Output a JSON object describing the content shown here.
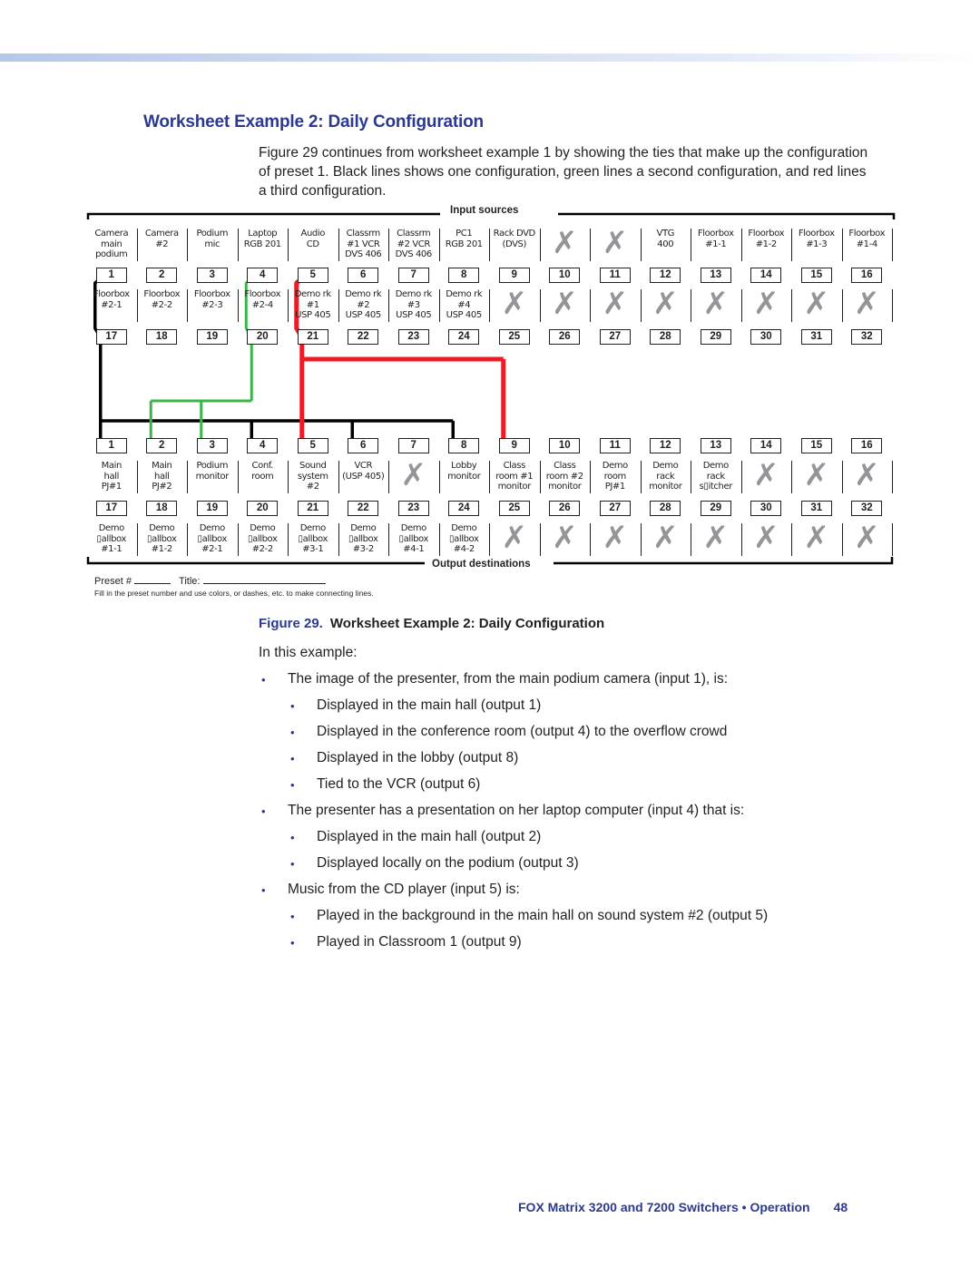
{
  "header": {
    "section_title": "Worksheet Example 2: Daily Configuration",
    "intro": "Figure 29 continues from worksheet example 1 by showing the ties that make up the configuration of preset 1. Black lines shows one configuration, green lines a second configuration, and red lines a third configuration."
  },
  "diagram": {
    "inputs_label": "Input  sources",
    "outputs_label": "Output destinations",
    "colors": {
      "black": "#000000",
      "green": "#39b54a",
      "red": "#ed1c24",
      "x_mark": "#939598"
    },
    "x_glyph": "✗",
    "inputs": [
      {
        "num": "1",
        "label": "Camera\nmain\npodium"
      },
      {
        "num": "2",
        "label": "Camera\n#2"
      },
      {
        "num": "3",
        "label": "Podium\nmic"
      },
      {
        "num": "4",
        "label": "Laptop\nRGB 201"
      },
      {
        "num": "5",
        "label": "Audio\nCD"
      },
      {
        "num": "6",
        "label": "Classrm\n#1 VCR\nDVS 406"
      },
      {
        "num": "7",
        "label": "Classrm\n#2 VCR\nDVS 406"
      },
      {
        "num": "8",
        "label": "PC1\nRGB 201"
      },
      {
        "num": "9",
        "label": "Rack DVD\n(DVS)"
      },
      {
        "num": "10",
        "label": null
      },
      {
        "num": "11",
        "label": null
      },
      {
        "num": "12",
        "label": "VTG\n400"
      },
      {
        "num": "13",
        "label": "Floorbox\n#1-1"
      },
      {
        "num": "14",
        "label": "Floorbox\n#1-2"
      },
      {
        "num": "15",
        "label": "Floorbox\n#1-3"
      },
      {
        "num": "16",
        "label": "Floorbox\n#1-4"
      },
      {
        "num": "17",
        "label": "Floorbox\n#2-1"
      },
      {
        "num": "18",
        "label": "Floorbox\n#2-2"
      },
      {
        "num": "19",
        "label": "Floorbox\n#2-3"
      },
      {
        "num": "20",
        "label": "Floorbox\n#2-4"
      },
      {
        "num": "21",
        "label": "Demo rk\n#1\nUSP 405"
      },
      {
        "num": "22",
        "label": "Demo rk\n#2\nUSP 405"
      },
      {
        "num": "23",
        "label": "Demo rk\n#3\nUSP 405"
      },
      {
        "num": "24",
        "label": "Demo rk\n#4\nUSP 405"
      },
      {
        "num": "25",
        "label": null
      },
      {
        "num": "26",
        "label": null
      },
      {
        "num": "27",
        "label": null
      },
      {
        "num": "28",
        "label": null
      },
      {
        "num": "29",
        "label": null
      },
      {
        "num": "30",
        "label": null
      },
      {
        "num": "31",
        "label": null
      },
      {
        "num": "32",
        "label": null
      }
    ],
    "outputs": [
      {
        "num": "1",
        "label": "Main\nhall\nPJ#1"
      },
      {
        "num": "2",
        "label": "Main\nhall\nPJ#2"
      },
      {
        "num": "3",
        "label": "Podium\nmonitor"
      },
      {
        "num": "4",
        "label": "Conf.\nroom"
      },
      {
        "num": "5",
        "label": "Sound\nsystem\n#2"
      },
      {
        "num": "6",
        "label": "VCR\n(USP 405)"
      },
      {
        "num": "7",
        "label": null
      },
      {
        "num": "8",
        "label": "Lobby\nmonitor"
      },
      {
        "num": "9",
        "label": "Class\nroom #1\nmonitor"
      },
      {
        "num": "10",
        "label": "Class\nroom #2\nmonitor"
      },
      {
        "num": "11",
        "label": "Demo\nroom\nPJ#1"
      },
      {
        "num": "12",
        "label": "Demo\nrack\nmonitor"
      },
      {
        "num": "13",
        "label": "Demo\nrack\ns▯itcher"
      },
      {
        "num": "14",
        "label": null
      },
      {
        "num": "15",
        "label": null
      },
      {
        "num": "16",
        "label": null
      },
      {
        "num": "17",
        "label": "Demo\n▯allbox\n#1-1"
      },
      {
        "num": "18",
        "label": "Demo\n▯allbox\n#1-2"
      },
      {
        "num": "19",
        "label": "Demo\n▯allbox\n#2-1"
      },
      {
        "num": "20",
        "label": "Demo\n▯allbox\n#2-2"
      },
      {
        "num": "21",
        "label": "Demo\n▯allbox\n#3-1"
      },
      {
        "num": "22",
        "label": "Demo\n▯allbox\n#3-2"
      },
      {
        "num": "23",
        "label": "Demo\n▯allbox\n#4-1"
      },
      {
        "num": "24",
        "label": "Demo\n▯allbox\n#4-2"
      },
      {
        "num": "25",
        "label": null
      },
      {
        "num": "26",
        "label": null
      },
      {
        "num": "27",
        "label": null
      },
      {
        "num": "28",
        "label": null
      },
      {
        "num": "29",
        "label": null
      },
      {
        "num": "30",
        "label": null
      },
      {
        "num": "31",
        "label": null
      },
      {
        "num": "32",
        "label": null
      }
    ],
    "ties": [
      {
        "color": "black",
        "input": 1,
        "outputs": [
          1,
          4,
          6,
          8
        ]
      },
      {
        "color": "green",
        "input": 4,
        "outputs": [
          2,
          3
        ]
      },
      {
        "color": "red",
        "input": 5,
        "outputs": [
          5,
          9
        ]
      }
    ],
    "preset_label": "Preset #",
    "title_label": "Title:",
    "fill_note": "Fill in the preset number and use colors, or dashes, etc. to make connecting lines."
  },
  "figure": {
    "number": "Figure 29.",
    "title": "Worksheet Example 2: Daily Configuration"
  },
  "body": {
    "lead": "In this example:",
    "bullets": [
      {
        "level": 1,
        "text": "The image of the presenter, from the main podium camera (input 1), is:"
      },
      {
        "level": 2,
        "text": "Displayed in the main hall (output 1)"
      },
      {
        "level": 2,
        "text": "Displayed in the conference room (output 4) to the overflow crowd"
      },
      {
        "level": 2,
        "text": "Displayed in the lobby (output 8)"
      },
      {
        "level": 2,
        "text": "Tied to the VCR (output 6)"
      },
      {
        "level": 1,
        "text": "The presenter has a presentation on her laptop computer (input 4) that is:"
      },
      {
        "level": 2,
        "text": "Displayed in the main hall (output 2)"
      },
      {
        "level": 2,
        "text": "Displayed locally on the podium (output 3)"
      },
      {
        "level": 1,
        "text": "Music from the CD player (input 5) is:"
      },
      {
        "level": 2,
        "text": "Played in the background in the main hall on sound system #2 (output 5)"
      },
      {
        "level": 2,
        "text": "Played in Classroom 1 (output 9)"
      }
    ],
    "bullet_glyph": "•"
  },
  "footer": {
    "title": "FOX Matrix 3200 and 7200 Switchers • Operation",
    "page": "48"
  }
}
